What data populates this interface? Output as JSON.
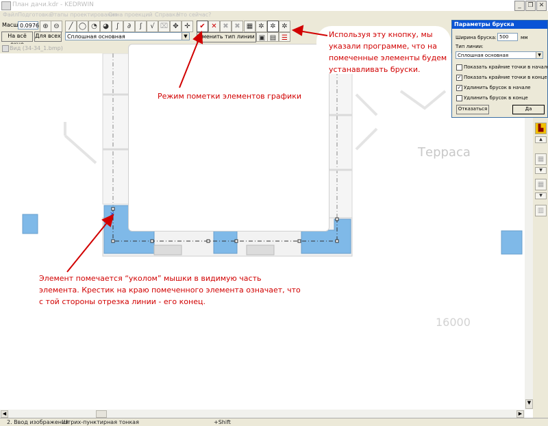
{
  "window": {
    "title": "План дачи.kdr - KEDRWIN",
    "minimize": "_",
    "maximize": "❐",
    "close": "✕"
  },
  "menu": [
    "Файл",
    "Подготовка",
    "Этапы проектирования",
    "Окна проекций",
    "Справка",
    "Что сейчас?"
  ],
  "toolbar": {
    "scale_label": "Масштаб",
    "scale_value": "0.0976",
    "fit_window_button": "На всё окно",
    "fit_all_button": "Для всех",
    "line_type_value": "Сплошная основная",
    "change_line_type_button": "Сменить тип линии"
  },
  "document": {
    "tab_title": "Вид (34-34_1.bmp)"
  },
  "drawing": {
    "room_label": "Терраса",
    "dimension_label": "16000"
  },
  "callouts": {
    "top_right": "Используя эту кнопку, мы указали программе, что на помеченные элементы будем устанавливать бруски.",
    "middle": "Режим пометки элементов графики",
    "bottom": "Элемент помечается “уколом” мышки в видимую часть элемента. Крестик на краю помеченного элемента означает, что с той стороны отрезка линии - его конец."
  },
  "dialog": {
    "title": "Параметры бруска",
    "width_label": "Ширина бруска:",
    "width_value": "500",
    "width_unit": "мм",
    "line_type_label": "Тип линии:",
    "line_type_value": "Сплошная основная",
    "options": [
      {
        "label": "Показать крайние точки в начале",
        "checked": false
      },
      {
        "label": "Показать крайние точки в конце",
        "checked": true
      },
      {
        "label": "Удлинить брусок в начале",
        "checked": true
      },
      {
        "label": "Удлинить брусок в конце",
        "checked": false
      }
    ],
    "cancel_button": "Отказаться",
    "ok_button": "Да"
  },
  "status": {
    "mode": "2. Ввод изображения",
    "line_type": "Штрих-пунктирная тонкая",
    "modifier": "+Shift"
  },
  "colors": {
    "accent_fill": "#7fb9e8",
    "callout_red": "#d10000",
    "dialog_caption": "#0a54d6"
  }
}
